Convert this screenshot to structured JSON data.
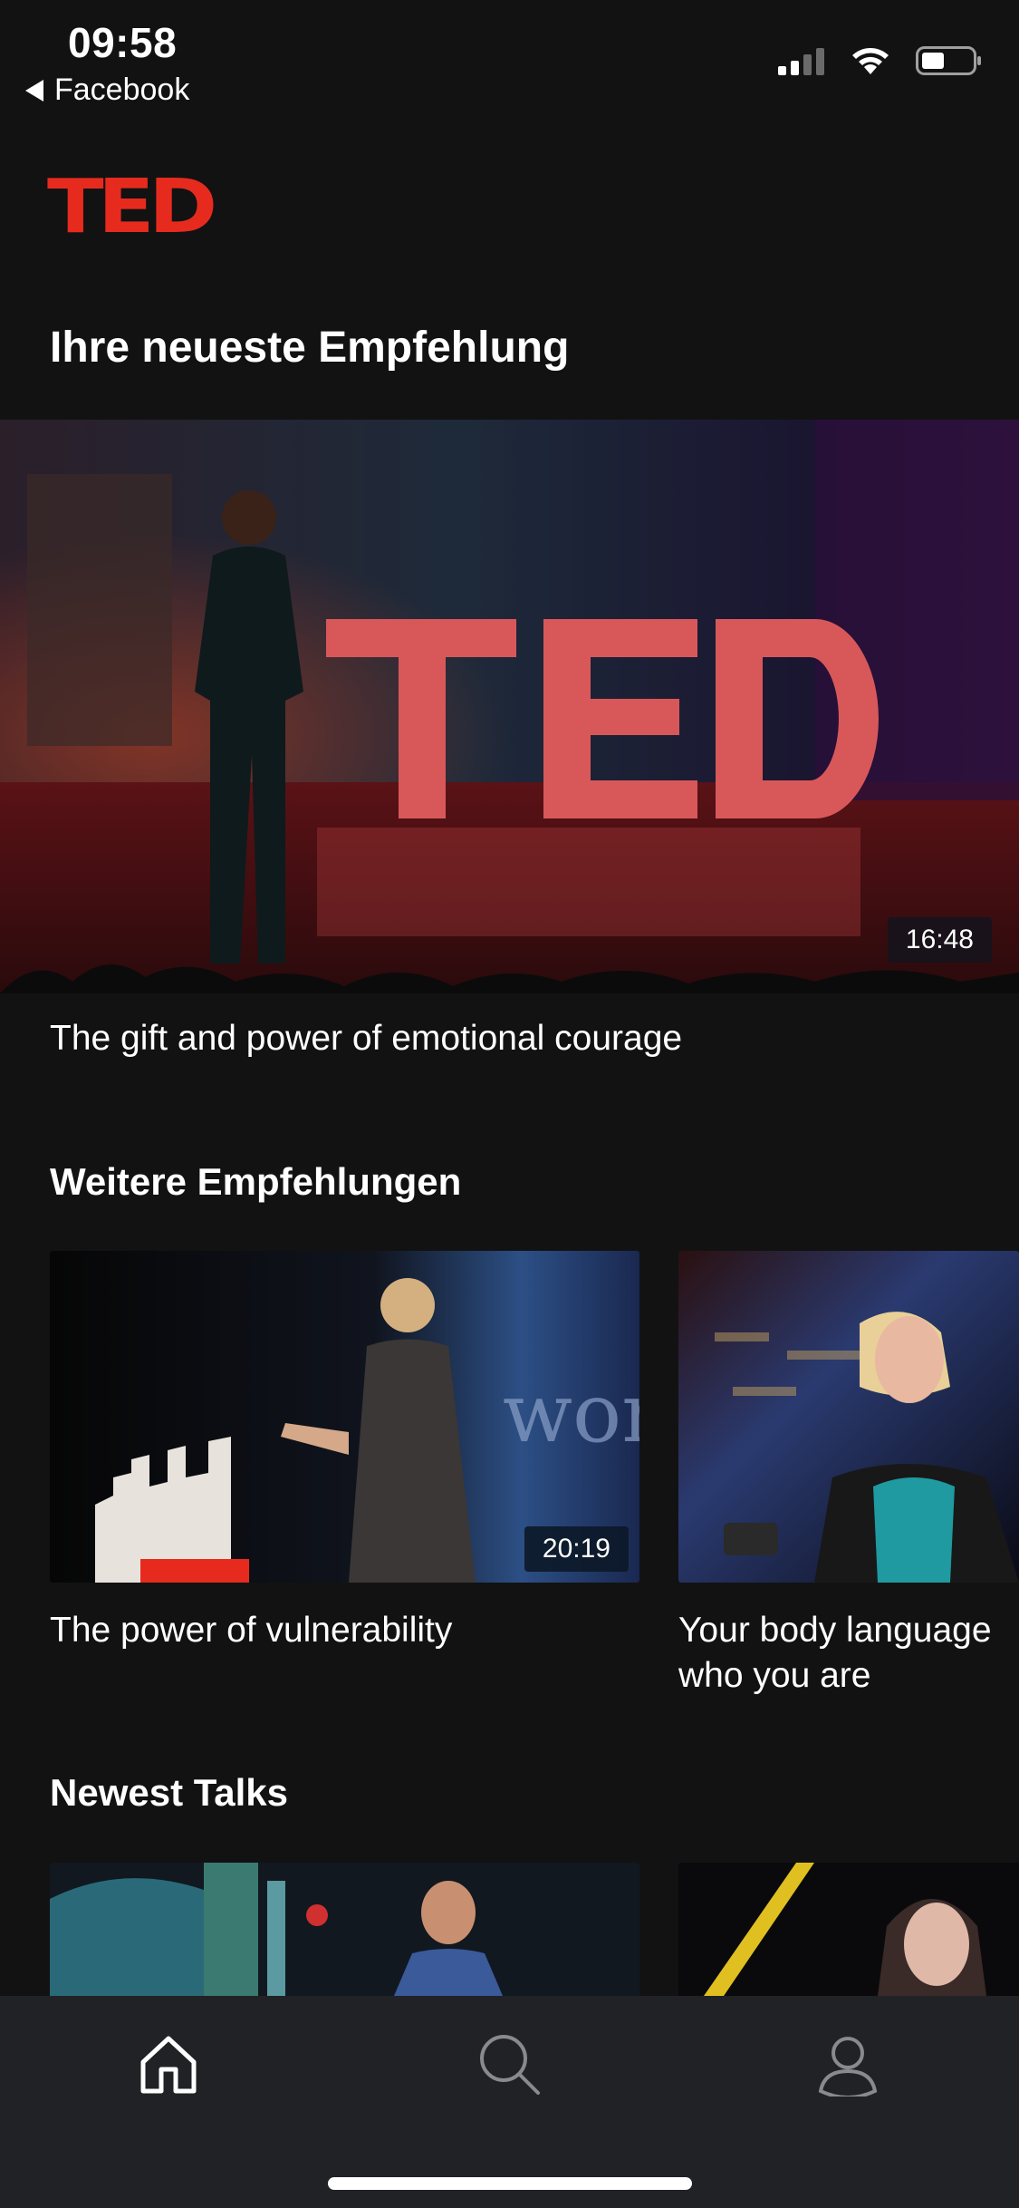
{
  "status_bar": {
    "time": "09:58",
    "back_app": "Facebook",
    "icons": [
      "cellular-signal-icon",
      "wifi-icon",
      "battery-icon"
    ]
  },
  "app": {
    "logo": "TED",
    "brand_color": "#e62b1e"
  },
  "featured": {
    "heading": "Ihre neueste Empfehlung",
    "talk": {
      "title": "The gift and power of emotional courage",
      "duration": "16:48"
    }
  },
  "recommendations": {
    "heading": "Weitere Empfehlungen",
    "items": [
      {
        "title": "The power of vulnerability",
        "duration": "20:19"
      },
      {
        "title": "Your body language may shape who you are",
        "title_visible_line1": "Your body language",
        "title_visible_line2": "who you are"
      }
    ]
  },
  "newest": {
    "heading": "Newest Talks"
  },
  "tab_bar": {
    "items": [
      {
        "name": "home",
        "icon": "home-icon",
        "active": true
      },
      {
        "name": "search",
        "icon": "search-icon",
        "active": false
      },
      {
        "name": "profile",
        "icon": "profile-icon",
        "active": false
      }
    ]
  }
}
